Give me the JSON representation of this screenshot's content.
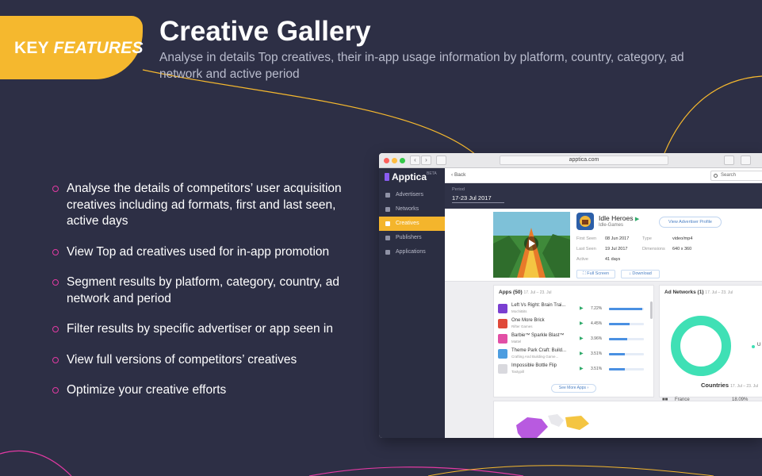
{
  "badge": {
    "word1": "KEY ",
    "word2": "FEATURES"
  },
  "header": {
    "title": "Creative Gallery",
    "subtitle": "Analyse in details Top creatives, their in-app usage information by platform, country, category, ad network and active period"
  },
  "features": [
    "Analyse the details of competitors’ user acquisition creatives including ad formats, first and last seen, active days",
    "View Top ad creatives used for in-app promotion",
    "Segment results by platform, category, country, ad network and period",
    "Filter results by specific advertiser or app seen in",
    "View full versions of competitors’ creatives",
    "Optimize your creative efforts"
  ],
  "colors": {
    "accent": "#f5b82e",
    "bullet": "#e23aa3",
    "background": "#2d2f45",
    "ring": "#3fe0b5"
  },
  "browser": {
    "url": "apptica.com",
    "nav_back_icon": "‹",
    "nav_forward_icon": "›"
  },
  "app": {
    "logo": "Apptica",
    "logo_tm": "BETA",
    "menu": [
      {
        "label": "Advertisers",
        "icon": "send-icon",
        "active": false
      },
      {
        "label": "Networks",
        "icon": "network-icon",
        "active": false
      },
      {
        "label": "Creatives",
        "icon": "brush-icon",
        "active": true
      },
      {
        "label": "Publishers",
        "icon": "bulb-icon",
        "active": false
      },
      {
        "label": "Applications",
        "icon": "grid-icon",
        "active": false
      }
    ],
    "back_label": "‹  Back",
    "search_placeholder": "Search",
    "period_label": "Period",
    "period_value": "17-23 Jul 2017",
    "creative": {
      "app_name": "Idle Heroes",
      "developer": "Idle-Games",
      "view_profile": "View Advertiser Profile",
      "first_seen_label": "First Seen",
      "first_seen": "08 Jun 2017",
      "last_seen_label": "Last Seen",
      "last_seen": "19 Jul 2017",
      "active_label": "Active",
      "active": "41 days",
      "type_label": "Type",
      "type": "video/mp4",
      "dimensions_label": "Dimensions",
      "dimensions": "640 x 360",
      "full_screen": "Full Screen",
      "download": "Download"
    },
    "apps_card": {
      "title": "Apps (50)",
      "date": "17. Jul – 23. Jul",
      "rows": [
        {
          "name": "Left Vs Right: Brain Trai...",
          "sub": "MochiBits",
          "pct": "7.22%",
          "fill": 0.95,
          "color": "#7a3fd1"
        },
        {
          "name": "One More Brick",
          "sub": "Rifter Games",
          "pct": "4.45%",
          "fill": 0.6,
          "color": "#e0493a"
        },
        {
          "name": "Barbie™ Sparkle Blast™",
          "sub": "Mattel",
          "pct": "3.96%",
          "fill": 0.52,
          "color": "#e24fa5"
        },
        {
          "name": "Theme Park Craft: Build...",
          "sub": "Crafting And Building Game...",
          "pct": "3.51%",
          "fill": 0.46,
          "color": "#4d9de0"
        },
        {
          "name": "Impossible Bottle Flip",
          "sub": "Tastypill",
          "pct": "3.51%",
          "fill": 0.46,
          "color": "#d9d9de"
        }
      ],
      "see_more": "See More Apps ›"
    },
    "networks_card": {
      "title": "Ad Networks (1)",
      "date": "17. Jul – 23. Jul",
      "legend": "U"
    },
    "countries": {
      "title": "Countries",
      "date": "17. Jul – 23. Jul",
      "first": "France",
      "first_pct": "18.09%"
    }
  }
}
